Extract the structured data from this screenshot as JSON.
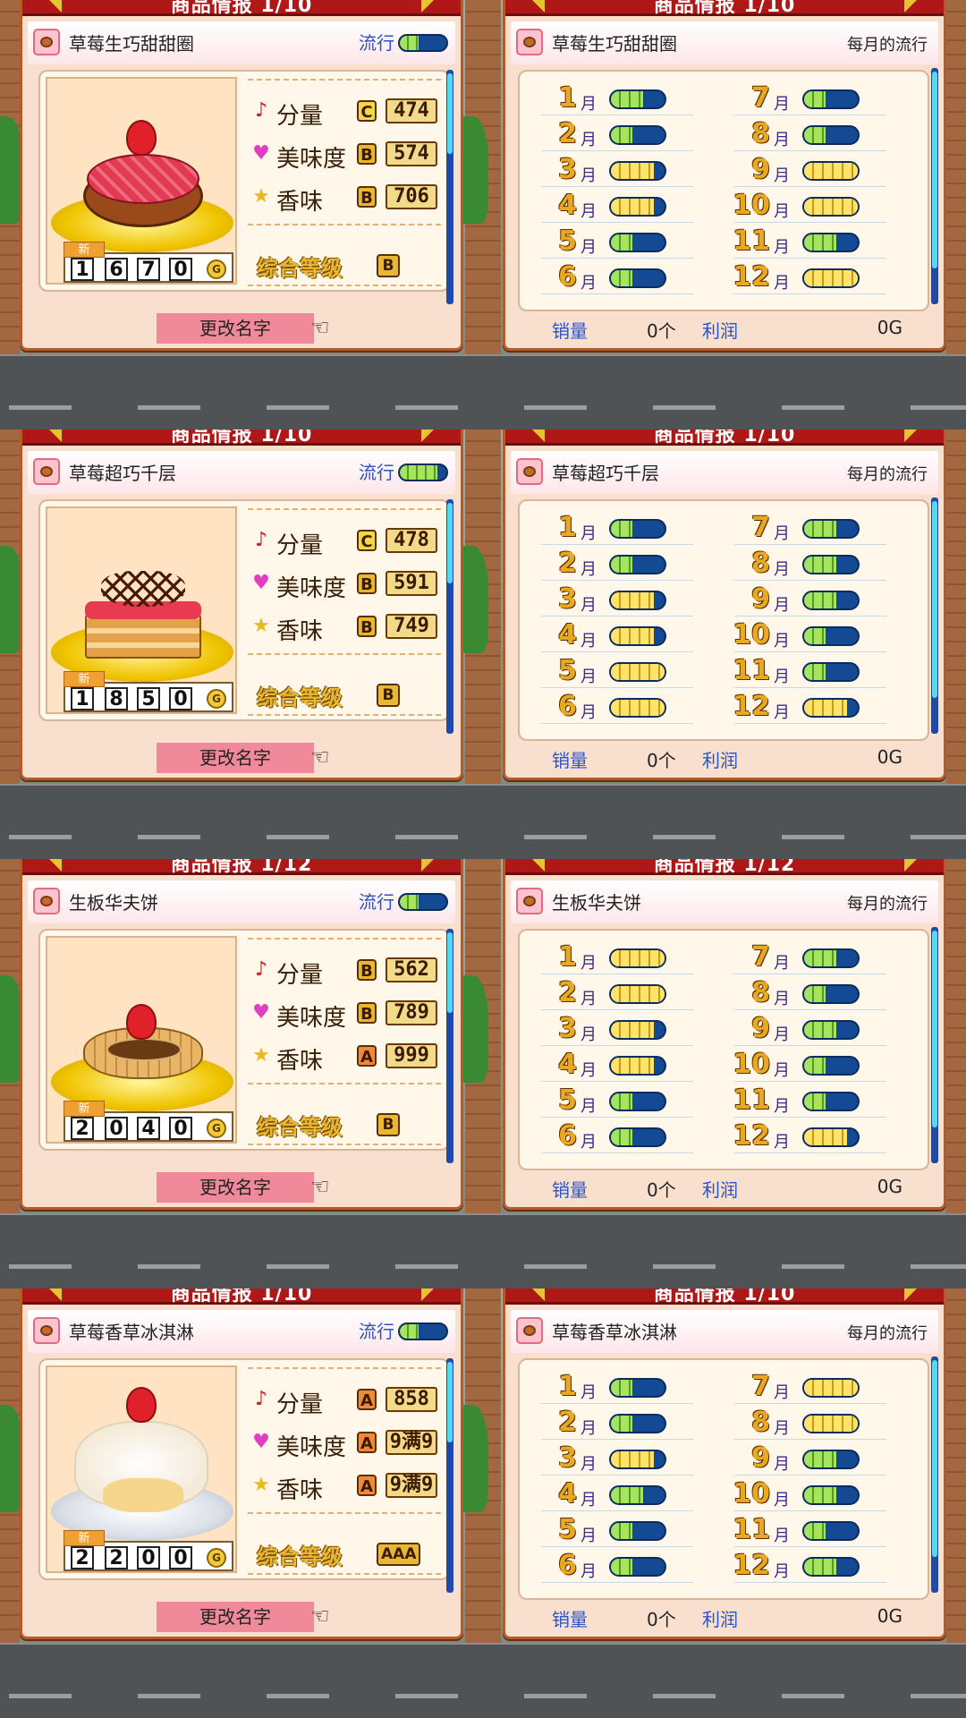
{
  "strips": [
    {
      "title": "商品情报 1/10",
      "name": "草莓生巧甜甜圈",
      "trend_label": "流行",
      "trend_level": 0.4,
      "stats": [
        {
          "label": "分量",
          "icon": "♪",
          "grade": "C",
          "value": "474"
        },
        {
          "label": "美味度",
          "icon": "♥",
          "grade": "B",
          "value": "574"
        },
        {
          "label": "香味",
          "icon": "★",
          "grade": "B",
          "value": "706"
        }
      ],
      "overall_label": "综合等级",
      "overall_grade": "B",
      "new_tag": "新",
      "price_digits": [
        "1",
        "6",
        "7",
        "0"
      ],
      "coin": "G",
      "rename": "更改名字",
      "monthly_label": "每月的流行",
      "month_suffix": "月",
      "months": [
        {
          "num": "1",
          "level": 3,
          "gold": false
        },
        {
          "num": "2",
          "level": 2,
          "gold": false
        },
        {
          "num": "3",
          "level": 4,
          "gold": true
        },
        {
          "num": "4",
          "level": 4,
          "gold": true
        },
        {
          "num": "5",
          "level": 2,
          "gold": false
        },
        {
          "num": "6",
          "level": 2,
          "gold": false
        },
        {
          "num": "7",
          "level": 2,
          "gold": false
        },
        {
          "num": "8",
          "level": 2,
          "gold": false
        },
        {
          "num": "9",
          "level": 5,
          "gold": true
        },
        {
          "num": "10",
          "level": 5,
          "gold": true
        },
        {
          "num": "11",
          "level": 3,
          "gold": false
        },
        {
          "num": "12",
          "level": 5,
          "gold": true
        }
      ],
      "sales_label": "销量",
      "sales_value": "0个",
      "profit_label": "利润",
      "profit_value": "0G",
      "dish": "donut"
    },
    {
      "title": "商品情报 1/10",
      "name": "草莓超巧千层",
      "trend_label": "流行",
      "trend_level": 0.8,
      "stats": [
        {
          "label": "分量",
          "icon": "♪",
          "grade": "C",
          "value": "478"
        },
        {
          "label": "美味度",
          "icon": "♥",
          "grade": "B",
          "value": "591"
        },
        {
          "label": "香味",
          "icon": "★",
          "grade": "B",
          "value": "749"
        }
      ],
      "overall_label": "综合等级",
      "overall_grade": "B",
      "new_tag": "新",
      "price_digits": [
        "1",
        "8",
        "5",
        "0"
      ],
      "coin": "G",
      "rename": "更改名字",
      "monthly_label": "每月的流行",
      "month_suffix": "月",
      "months": [
        {
          "num": "1",
          "level": 2,
          "gold": false
        },
        {
          "num": "2",
          "level": 2,
          "gold": false
        },
        {
          "num": "3",
          "level": 4,
          "gold": true
        },
        {
          "num": "4",
          "level": 4,
          "gold": true
        },
        {
          "num": "5",
          "level": 5,
          "gold": true
        },
        {
          "num": "6",
          "level": 5,
          "gold": true
        },
        {
          "num": "7",
          "level": 3,
          "gold": false
        },
        {
          "num": "8",
          "level": 3,
          "gold": false
        },
        {
          "num": "9",
          "level": 3,
          "gold": false
        },
        {
          "num": "10",
          "level": 2,
          "gold": false
        },
        {
          "num": "11",
          "level": 2,
          "gold": false
        },
        {
          "num": "12",
          "level": 4,
          "gold": true
        }
      ],
      "sales_label": "销量",
      "sales_value": "0个",
      "profit_label": "利润",
      "profit_value": "0G",
      "dish": "millefeuille"
    },
    {
      "title": "商品情报 1/12",
      "name": "生板华夫饼",
      "trend_label": "流行",
      "trend_level": 0.4,
      "stats": [
        {
          "label": "分量",
          "icon": "♪",
          "grade": "B",
          "value": "562"
        },
        {
          "label": "美味度",
          "icon": "♥",
          "grade": "B",
          "value": "789"
        },
        {
          "label": "香味",
          "icon": "★",
          "grade": "A",
          "value": "999"
        }
      ],
      "overall_label": "综合等级",
      "overall_grade": "B",
      "new_tag": "新",
      "price_digits": [
        "2",
        "0",
        "4",
        "0"
      ],
      "coin": "G",
      "rename": "更改名字",
      "monthly_label": "每月的流行",
      "month_suffix": "月",
      "months": [
        {
          "num": "1",
          "level": 5,
          "gold": true
        },
        {
          "num": "2",
          "level": 5,
          "gold": true
        },
        {
          "num": "3",
          "level": 4,
          "gold": true
        },
        {
          "num": "4",
          "level": 4,
          "gold": true
        },
        {
          "num": "5",
          "level": 2,
          "gold": false
        },
        {
          "num": "6",
          "level": 2,
          "gold": false
        },
        {
          "num": "7",
          "level": 3,
          "gold": false
        },
        {
          "num": "8",
          "level": 2,
          "gold": false
        },
        {
          "num": "9",
          "level": 3,
          "gold": false
        },
        {
          "num": "10",
          "level": 2,
          "gold": false
        },
        {
          "num": "11",
          "level": 2,
          "gold": false
        },
        {
          "num": "12",
          "level": 4,
          "gold": true
        }
      ],
      "sales_label": "销量",
      "sales_value": "0个",
      "profit_label": "利润",
      "profit_value": "0G",
      "dish": "waffle"
    },
    {
      "title": "商品情报 1/10",
      "name": "草莓香草冰淇淋",
      "trend_label": "流行",
      "trend_level": 0.4,
      "stats": [
        {
          "label": "分量",
          "icon": "♪",
          "grade": "A",
          "value": "858"
        },
        {
          "label": "美味度",
          "icon": "♥",
          "grade": "A",
          "value": "9满9"
        },
        {
          "label": "香味",
          "icon": "★",
          "grade": "A",
          "value": "9满9"
        }
      ],
      "overall_label": "综合等级",
      "overall_grade": "AAA",
      "new_tag": "新",
      "price_digits": [
        "2",
        "2",
        "0",
        "0"
      ],
      "coin": "G",
      "rename": "更改名字",
      "monthly_label": "每月的流行",
      "month_suffix": "月",
      "months": [
        {
          "num": "1",
          "level": 2,
          "gold": false
        },
        {
          "num": "2",
          "level": 2,
          "gold": false
        },
        {
          "num": "3",
          "level": 4,
          "gold": true
        },
        {
          "num": "4",
          "level": 3,
          "gold": false
        },
        {
          "num": "5",
          "level": 2,
          "gold": false
        },
        {
          "num": "6",
          "level": 2,
          "gold": false
        },
        {
          "num": "7",
          "level": 5,
          "gold": true
        },
        {
          "num": "8",
          "level": 5,
          "gold": true
        },
        {
          "num": "9",
          "level": 3,
          "gold": false
        },
        {
          "num": "10",
          "level": 3,
          "gold": false
        },
        {
          "num": "11",
          "level": 2,
          "gold": false
        },
        {
          "num": "12",
          "level": 3,
          "gold": false
        }
      ],
      "sales_label": "销量",
      "sales_value": "0个",
      "profit_label": "利润",
      "profit_value": "0G",
      "dish": "icecream"
    }
  ],
  "colors": {
    "grade_A": "#f08a3a",
    "grade_B": "#e8b830",
    "grade_C": "#f0d84a"
  }
}
